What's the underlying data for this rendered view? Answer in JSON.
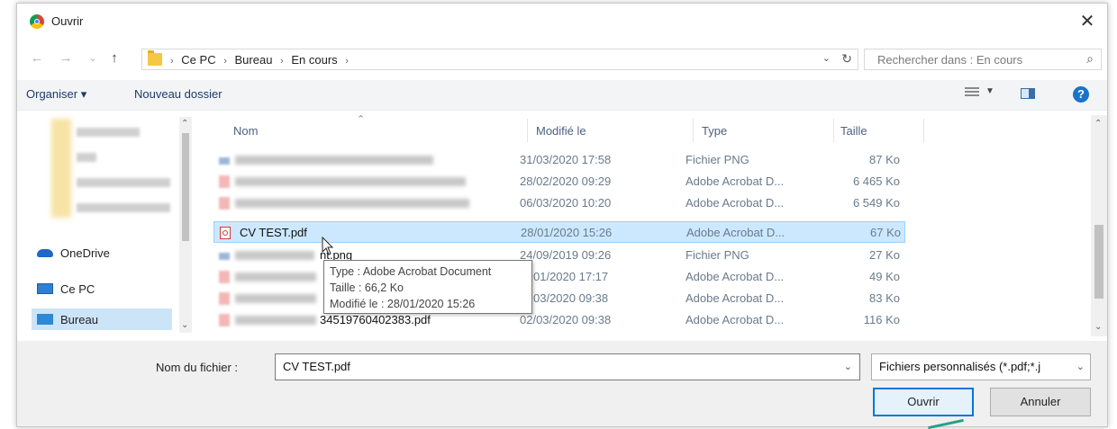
{
  "window": {
    "title": "Ouvrir",
    "close_glyph": "✕"
  },
  "nav": {
    "back_glyph": "←",
    "forward_glyph": "→",
    "history_glyph": "⌄",
    "up_glyph": "↑",
    "breadcrumb": [
      "Ce PC",
      "Bureau",
      "En cours"
    ],
    "separator": "›",
    "search_placeholder": "Rechercher dans : En cours"
  },
  "toolbar": {
    "organize_label": "Organiser ▾",
    "new_folder_label": "Nouveau dossier",
    "help_label": "?"
  },
  "sidebar": {
    "items": [
      "OneDrive",
      "Ce PC",
      "Bureau"
    ],
    "selected": "Bureau"
  },
  "columns": {
    "name": "Nom",
    "modified": "Modifié le",
    "type": "Type",
    "size": "Taille"
  },
  "files": [
    {
      "name": "",
      "modified": "31/03/2020 17:58",
      "type": "Fichier PNG",
      "size": "87 Ko",
      "kind": "png"
    },
    {
      "name": "",
      "modified": "28/02/2020 09:29",
      "type": "Adobe Acrobat D...",
      "size": "6 465 Ko",
      "kind": "pdf"
    },
    {
      "name": "",
      "modified": "06/03/2020 10:20",
      "type": "Adobe Acrobat D...",
      "size": "6 549 Ko",
      "kind": "pdf"
    },
    {
      "name": "CV TEST.pdf",
      "modified": "28/01/2020 15:26",
      "type": "Adobe Acrobat D...",
      "size": "67 Ko",
      "kind": "pdf",
      "selected": true
    },
    {
      "name": "nt.png",
      "modified": "24/09/2019 09:26",
      "type": "Fichier PNG",
      "size": "27 Ko",
      "kind": "png"
    },
    {
      "name": "",
      "modified": "01/2020 17:17",
      "type": "Adobe Acrobat D...",
      "size": "49 Ko",
      "kind": "pdf"
    },
    {
      "name": "",
      "modified": "03/2020 09:38",
      "type": "Adobe Acrobat D...",
      "size": "83 Ko",
      "kind": "pdf"
    },
    {
      "name": "34519760402383.pdf",
      "modified": "02/03/2020 09:38",
      "type": "Adobe Acrobat D...",
      "size": "116 Ko",
      "kind": "pdf"
    }
  ],
  "tooltip": {
    "line1": "Type : Adobe Acrobat Document",
    "line2": "Taille : 66,2 Ko",
    "line3": "Modifié le : 28/01/2020 15:26"
  },
  "bottom": {
    "filename_label": "Nom du fichier :",
    "filename_value": "CV TEST.pdf",
    "filetype_value": "Fichiers personnalisés (*.pdf;*.j",
    "open_label": "Ouvrir",
    "cancel_label": "Annuler"
  },
  "colors": {
    "selection": "#cce8ff",
    "selection_border": "#99d1ff",
    "primary_border": "#0078d7",
    "header_text": "#4d6082"
  }
}
